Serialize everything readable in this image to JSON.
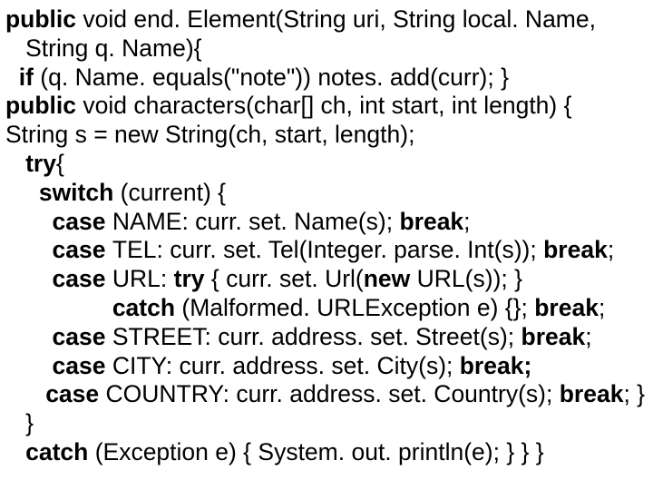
{
  "lines": [
    {
      "parts": [
        {
          "t": "public",
          "b": true
        },
        {
          "t": " void end. Element(String uri, String local. Name,"
        }
      ],
      "pad": 0
    },
    {
      "parts": [
        {
          "t": "String q. Name){"
        }
      ],
      "pad": 3
    },
    {
      "parts": [
        {
          "t": "if ",
          "b": true
        },
        {
          "t": "(q. Name. equals(\"note\")) notes. add(curr); }"
        }
      ],
      "pad": 2
    },
    {
      "parts": [
        {
          "t": "public ",
          "b": true
        },
        {
          "t": "void characters(char[] ch, int start, int length) {"
        }
      ],
      "pad": 0
    },
    {
      "parts": [
        {
          "t": "String s = new String(ch, start, length);"
        }
      ],
      "pad": 0
    },
    {
      "parts": [
        {
          "t": "try",
          "b": true
        },
        {
          "t": "{"
        }
      ],
      "pad": 3
    },
    {
      "parts": [
        {
          "t": "switch ",
          "b": true
        },
        {
          "t": "(current) {"
        }
      ],
      "pad": 5
    },
    {
      "parts": [
        {
          "t": "case ",
          "b": true
        },
        {
          "t": "NAME: curr. set. Name(s); "
        },
        {
          "t": "break",
          "b": true
        },
        {
          "t": ";"
        }
      ],
      "pad": 7
    },
    {
      "parts": [
        {
          "t": "case ",
          "b": true
        },
        {
          "t": "TEL: curr. set. Tel(Integer. parse. Int(s)); "
        },
        {
          "t": "break",
          "b": true
        },
        {
          "t": ";"
        }
      ],
      "pad": 7
    },
    {
      "parts": [
        {
          "t": "case ",
          "b": true
        },
        {
          "t": "URL: "
        },
        {
          "t": "try",
          "b": true
        },
        {
          "t": " { curr. set. Url("
        },
        {
          "t": "new",
          "b": true
        },
        {
          "t": " URL(s)); }"
        }
      ],
      "pad": 7
    },
    {
      "parts": [
        {
          "t": "catch ",
          "b": true
        },
        {
          "t": "(Malformed. URLException e) {}; "
        },
        {
          "t": "break",
          "b": true
        },
        {
          "t": ";"
        }
      ],
      "pad": 16
    },
    {
      "parts": [
        {
          "t": "case ",
          "b": true
        },
        {
          "t": "STREET: curr. address. set. Street(s); "
        },
        {
          "t": "break",
          "b": true
        },
        {
          "t": ";"
        }
      ],
      "pad": 7
    },
    {
      "parts": [
        {
          "t": "case ",
          "b": true
        },
        {
          "t": "CITY: curr. address. set. City(s); "
        },
        {
          "t": "break;",
          "b": true
        }
      ],
      "pad": 7
    },
    {
      "parts": [
        {
          "t": "case ",
          "b": true
        },
        {
          "t": "COUNTRY: curr. address. set. Country(s); "
        },
        {
          "t": "break",
          "b": true
        },
        {
          "t": "; }"
        }
      ],
      "pad": 6
    },
    {
      "parts": [
        {
          "t": "}"
        }
      ],
      "pad": 3
    },
    {
      "parts": [
        {
          "t": "catch ",
          "b": true
        },
        {
          "t": "(Exception e) { System. out. println(e); } } }"
        }
      ],
      "pad": 3
    }
  ]
}
